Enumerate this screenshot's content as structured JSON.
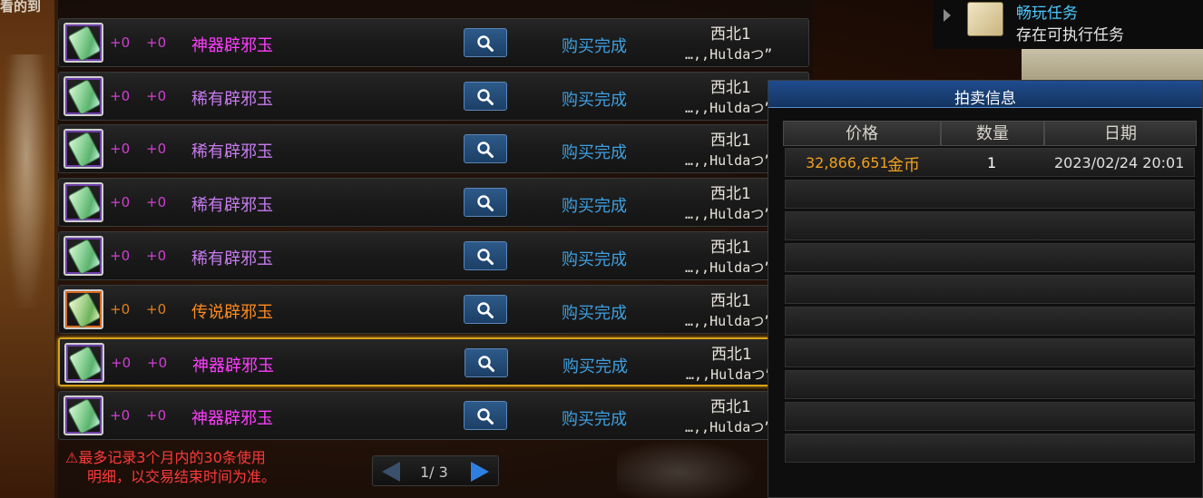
{
  "background": {
    "left_title": "看的到"
  },
  "rows": [
    {
      "grade": "artifact",
      "plus1": "+0",
      "plus2": "+0",
      "name": "神器辟邪玉",
      "status": "购买完成",
      "server": "西北1",
      "buyer": "…,,Huldaつ”"
    },
    {
      "grade": "rare",
      "plus1": "+0",
      "plus2": "+0",
      "name": "稀有辟邪玉",
      "status": "购买完成",
      "server": "西北1",
      "buyer": "…,,Huldaつ”"
    },
    {
      "grade": "rare",
      "plus1": "+0",
      "plus2": "+0",
      "name": "稀有辟邪玉",
      "status": "购买完成",
      "server": "西北1",
      "buyer": "…,,Huldaつ”"
    },
    {
      "grade": "rare",
      "plus1": "+0",
      "plus2": "+0",
      "name": "稀有辟邪玉",
      "status": "购买完成",
      "server": "西北1",
      "buyer": "…,,Huldaつ”"
    },
    {
      "grade": "rare",
      "plus1": "+0",
      "plus2": "+0",
      "name": "稀有辟邪玉",
      "status": "购买完成",
      "server": "西北1",
      "buyer": "…,,Huldaつ”"
    },
    {
      "grade": "legend",
      "plus1": "+0",
      "plus2": "+0",
      "name": "传说辟邪玉",
      "status": "购买完成",
      "server": "西北1",
      "buyer": "…,,Huldaつ”"
    },
    {
      "grade": "artifact",
      "plus1": "+0",
      "plus2": "+0",
      "name": "神器辟邪玉",
      "status": "购买完成",
      "server": "西北1",
      "buyer": "…,,Huldaつ”",
      "selected": true
    },
    {
      "grade": "artifact",
      "plus1": "+0",
      "plus2": "+0",
      "name": "神器辟邪玉",
      "status": "购买完成",
      "server": "西北1",
      "buyer": "…,,Huldaつ”"
    }
  ],
  "note": {
    "icon": "warning-icon",
    "line1": "最多记录3个月内的30条使用",
    "line2": "明细，以交易结束时间为准。"
  },
  "pager": {
    "text": "1/ 3"
  },
  "quest": {
    "line1": "畅玩任务",
    "line2": "存在可执行任务"
  },
  "auction": {
    "title": "拍卖信息",
    "headers": {
      "price": "价格",
      "qty": "数量",
      "date": "日期"
    },
    "entries": [
      {
        "price": "32,866,651",
        "currency": "金币",
        "qty": "1",
        "date": "2023/02/24 20:01"
      }
    ]
  },
  "colors": {
    "artifact": "#ff3cff",
    "rare": "#c77cf0",
    "legend": "#ff8a1e",
    "status": "#3f9fe0",
    "accent_blue": "#1f4c8e",
    "selected_border": "#d8a21c"
  }
}
